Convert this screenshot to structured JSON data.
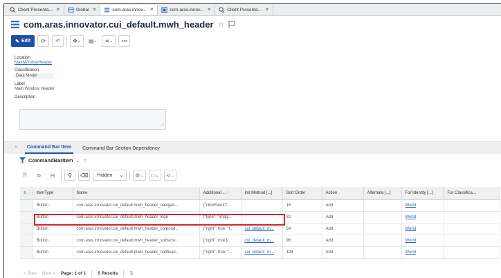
{
  "tabs": [
    {
      "label": "Client Presenta...",
      "icon": "search-icon",
      "active": false
    },
    {
      "label": "Global",
      "icon": "itemtype-icon",
      "active": false
    },
    {
      "label": "com.aras.innov...",
      "icon": "form-icon",
      "active": true
    },
    {
      "label": "com.aras.innov...",
      "icon": "itemtype-icon",
      "active": false
    },
    {
      "label": "Client Presenta...",
      "icon": "search-icon",
      "active": false
    }
  ],
  "item": {
    "title": "com.aras.innovator.cui_default.mwh_header"
  },
  "toolbar": {
    "edit_label": "Edit"
  },
  "fields": {
    "location_label": "Location",
    "location_value": "MainWindowHeader",
    "classification_label": "Classification",
    "classification_value": "Data Model",
    "label_label": "Label",
    "label_value": "Main Window Header",
    "description_label": "Description"
  },
  "relationships": {
    "tabs": [
      "Command Bar Item",
      "Command Bar Section Dependency"
    ],
    "grid_title": "CommandBarItem",
    "filter_select": "Hidden"
  },
  "grid": {
    "columns": [
      "ItemType",
      "Name",
      "Additional ... ↑",
      "Init Method [...]",
      "Sort Order",
      "Action",
      "Alternate [...]",
      "For Identity [...]",
      "For Classifica..."
    ],
    "rows": [
      [
        "Button",
        "com.aras.innovator.cui_default.mwh_header_navigati...",
        "{\"clickEventT...",
        "",
        "16",
        "Add",
        "",
        "World",
        ""
      ],
      [
        "Button",
        "com.aras.innovator.cui_default.mwh_header_logo",
        "{\"type\": \"imag...",
        "",
        "32",
        "Add",
        "",
        "World",
        ""
      ],
      [
        "Button",
        "com.aras.innovator.cui_default.mwh_header_corporat...",
        "{\"right\": true, \"t...",
        "cui_default_m...",
        "64",
        "Add",
        "",
        "World",
        ""
      ],
      [
        "Button",
        "com.aras.innovator.cui_default.mwh_header_splitscre...",
        "{\"right\": true }",
        "cui_default_m...",
        "96",
        "Add",
        "",
        "World",
        ""
      ],
      [
        "Button",
        "com.aras.innovator.cui_default.mwh_header_notificati...",
        "{\"right\": true, \"...",
        "cui_default_m...",
        "128",
        "Add",
        "",
        "World",
        ""
      ]
    ]
  },
  "pager": {
    "prev": "< Prev",
    "next": "Next >",
    "page": "Page: 1 of 1",
    "results": "5 Results"
  },
  "colors": {
    "accent": "#1f4ea8",
    "link": "#2a66c2",
    "highlight": "#d6232a"
  }
}
